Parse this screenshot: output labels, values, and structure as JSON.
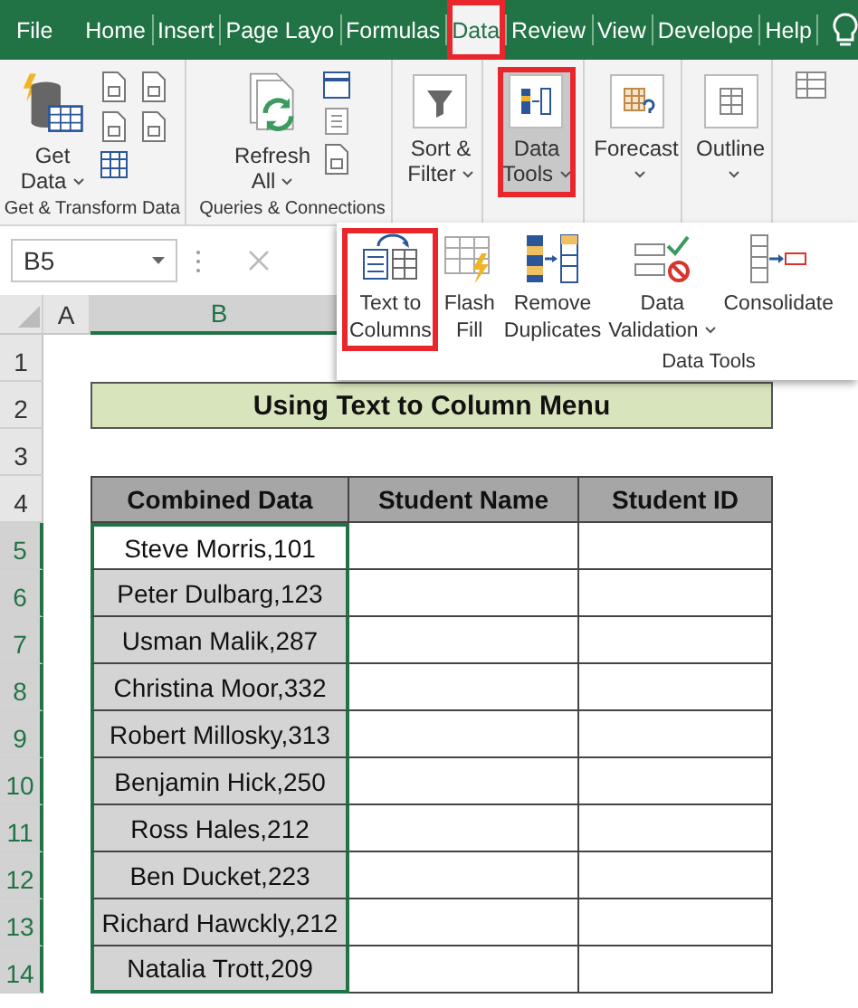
{
  "tabs": [
    {
      "label": "File",
      "selected": false,
      "marked": false
    },
    {
      "label": "Home",
      "selected": false,
      "marked": false
    },
    {
      "label": "Insert",
      "selected": false,
      "marked": false
    },
    {
      "label": "Page Layo",
      "selected": false,
      "marked": false
    },
    {
      "label": "Formulas",
      "selected": false,
      "marked": false
    },
    {
      "label": "Data",
      "selected": true,
      "marked": true
    },
    {
      "label": "Review",
      "selected": false,
      "marked": false
    },
    {
      "label": "View",
      "selected": false,
      "marked": false
    },
    {
      "label": "Develope",
      "selected": false,
      "marked": false
    },
    {
      "label": "Help",
      "selected": false,
      "marked": false
    }
  ],
  "ribbon": {
    "groups": [
      {
        "label": "Get & Transform Data",
        "buttons": [
          {
            "lines": [
              "Get",
              "Data"
            ],
            "dropdown": true,
            "selected": false,
            "marked": false
          }
        ]
      },
      {
        "label": "Queries & Connections",
        "buttons": [
          {
            "lines": [
              "Refresh",
              "All"
            ],
            "dropdown": true,
            "selected": false,
            "marked": false
          }
        ]
      },
      {
        "buttons": [
          {
            "lines": [
              "Sort &",
              "Filter"
            ],
            "dropdown": true,
            "selected": false,
            "marked": false
          }
        ]
      },
      {
        "buttons": [
          {
            "lines": [
              "Data",
              "Tools"
            ],
            "dropdown": true,
            "selected": true,
            "marked": true
          }
        ]
      },
      {
        "buttons": [
          {
            "lines": [
              "Forecast"
            ],
            "dropdown": true,
            "selected": false,
            "marked": false
          }
        ]
      },
      {
        "buttons": [
          {
            "lines": [
              "Outline"
            ],
            "dropdown": true,
            "selected": false,
            "marked": false
          }
        ]
      }
    ]
  },
  "formula_bar": {
    "name_box": "B5"
  },
  "data_tools_menu": {
    "label": "Data Tools",
    "items": [
      {
        "lines": [
          "Text to",
          "Columns"
        ],
        "dropdown": false,
        "marked": true
      },
      {
        "lines": [
          "Flash",
          "Fill"
        ],
        "dropdown": false,
        "marked": false
      },
      {
        "lines": [
          "Remove",
          "Duplicates"
        ],
        "dropdown": false,
        "marked": false
      },
      {
        "lines": [
          "Data",
          "Validation"
        ],
        "dropdown": true,
        "marked": false
      },
      {
        "lines": [
          "Consolidate"
        ],
        "dropdown": false,
        "marked": false
      }
    ]
  },
  "sheet": {
    "columns": [
      {
        "label": "A",
        "selected": false
      },
      {
        "label": "B",
        "selected": true
      }
    ],
    "row_numbers": [
      {
        "label": "1",
        "selected": false
      },
      {
        "label": "2",
        "selected": false
      },
      {
        "label": "3",
        "selected": false
      },
      {
        "label": "4",
        "selected": false
      },
      {
        "label": "5",
        "selected": true
      },
      {
        "label": "6",
        "selected": true
      },
      {
        "label": "7",
        "selected": true
      },
      {
        "label": "8",
        "selected": true
      },
      {
        "label": "9",
        "selected": true
      },
      {
        "label": "10",
        "selected": true
      },
      {
        "label": "11",
        "selected": true
      },
      {
        "label": "12",
        "selected": true
      },
      {
        "label": "13",
        "selected": true
      },
      {
        "label": "14",
        "selected": true
      }
    ],
    "title": "Using Text to Column Menu",
    "table": {
      "columns": [
        "Combined Data",
        "Student Name",
        "Student ID"
      ],
      "rows": [
        {
          "combined": "Steve Morris,101",
          "selected": true,
          "active": true
        },
        {
          "combined": "Peter Dulbarg,123",
          "selected": true,
          "active": false
        },
        {
          "combined": "Usman Malik,287",
          "selected": true,
          "active": false
        },
        {
          "combined": "Christina Moor,332",
          "selected": true,
          "active": false
        },
        {
          "combined": "Robert Millosky,313",
          "selected": true,
          "active": false
        },
        {
          "combined": "Benjamin Hick,250",
          "selected": true,
          "active": false
        },
        {
          "combined": "Ross Hales,212",
          "selected": true,
          "active": false
        },
        {
          "combined": "Ben Ducket,223",
          "selected": true,
          "active": false
        },
        {
          "combined": "Richard Hawckly,212",
          "selected": true,
          "active": false
        },
        {
          "combined": "Natalia Trott,209",
          "selected": true,
          "active": false
        }
      ]
    }
  }
}
